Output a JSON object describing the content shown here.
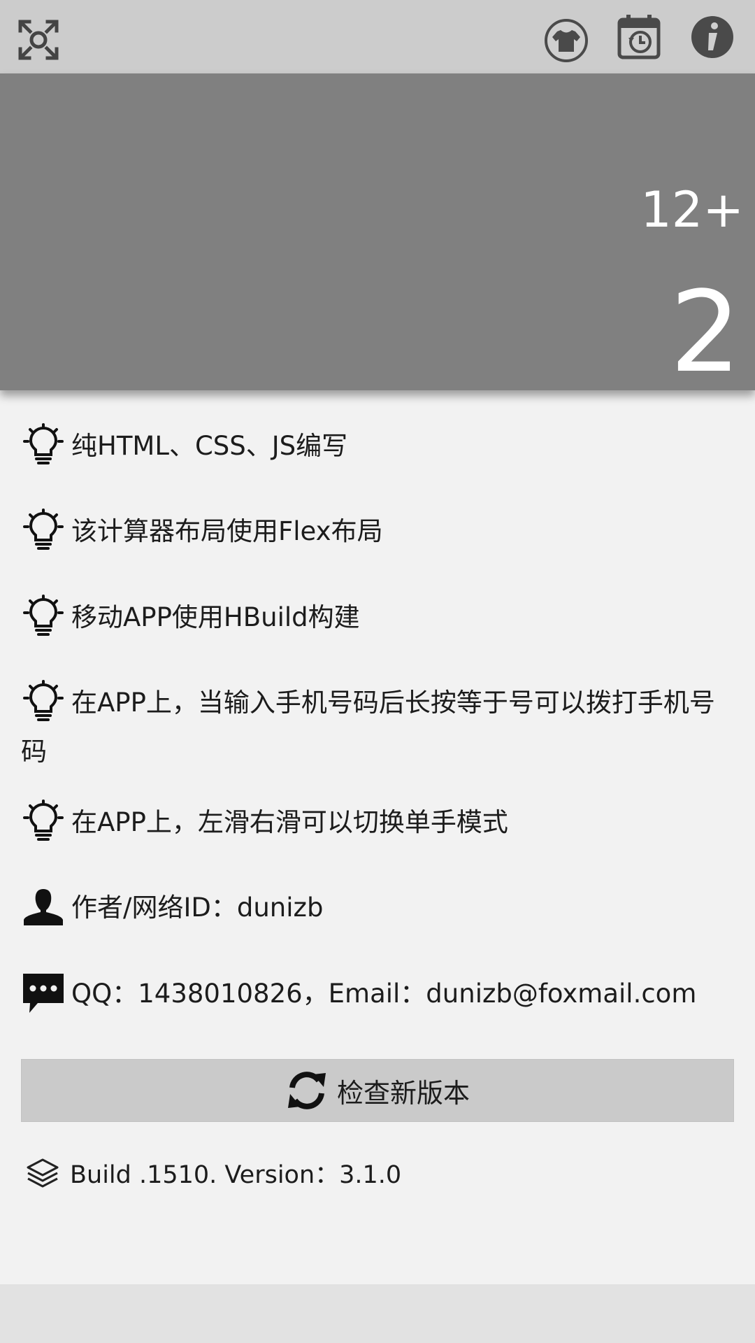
{
  "toolbar": {
    "icons": [
      "fullscreen-icon",
      "tshirt-icon",
      "calendar-history-icon",
      "info-icon"
    ]
  },
  "display": {
    "expression": "12+",
    "result": "2"
  },
  "info": {
    "items": [
      {
        "icon": "lightbulb-icon",
        "text": "纯HTML、CSS、JS编写"
      },
      {
        "icon": "lightbulb-icon",
        "text": "该计算器布局使用Flex布局"
      },
      {
        "icon": "lightbulb-icon",
        "text": "移动APP使用HBuild构建"
      },
      {
        "icon": "lightbulb-icon",
        "text": "在APP上，当输入手机号码后长按等于号可以拨打手机号码"
      },
      {
        "icon": "lightbulb-icon",
        "text": "在APP上，左滑右滑可以切换单手模式"
      },
      {
        "icon": "user-icon",
        "text": "作者/网络ID：dunizb"
      },
      {
        "icon": "comment-icon",
        "text": "QQ：1438010826，Email：dunizb@foxmail.com"
      }
    ],
    "update_button": {
      "icon": "refresh-icon",
      "label": "检查新版本"
    },
    "build": {
      "icon": "layers-icon",
      "text": "Build .1510. Version：3.1.0"
    }
  },
  "colors": {
    "toolbar_bg": "#cccccc",
    "display_bg": "#808080",
    "panel_bg": "#f2f2f2",
    "button_bg": "#cacaca",
    "footer_bg": "#e2e2e2",
    "icon_dark": "#4a4a4a"
  }
}
